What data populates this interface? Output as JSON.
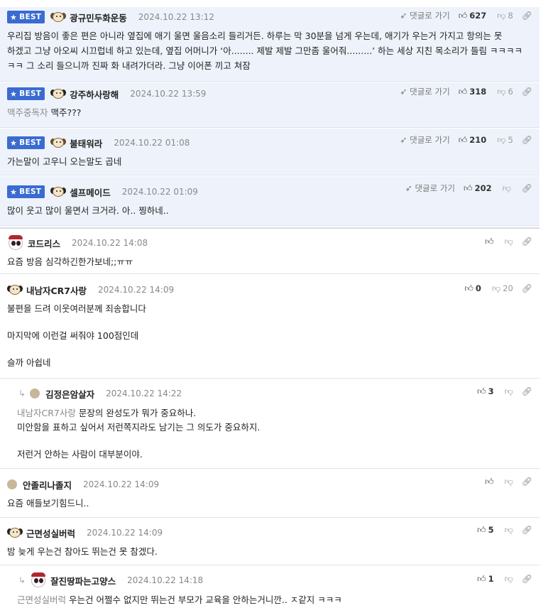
{
  "ui": {
    "best_label": "BEST",
    "goto_label": "댓글로 가기"
  },
  "comments": [
    {
      "nick": "광규민두화운동",
      "date": "2024.10.22 13:12",
      "likes": "627",
      "dislikes": "8",
      "lines": [
        "우리집 방음이 좋은 편은 아니라 옆집에 애기 울면 울음소리 들리거든. 하루는 막 30분을 넘게 우는데, 애기가 우는거 가지고 항의는 못",
        "하겠고 그냥 아오씨 시끄럽네 하고 있는데, 옆집 어머니가 ‘아........ 제발 제발 그만좀 울어줘.........’ 하는 세상 지친 목소리가 들림 ㅋㅋㅋㅋ",
        "ㅋㅋ 그 소리 들으니까 진짜 화 내려가더라. 그냥 이어폰 끼고 쳐잠"
      ]
    },
    {
      "nick": "강주하사랑해",
      "date": "2024.10.22 13:59",
      "likes": "318",
      "dislikes": "6",
      "ref": "맥주중독자",
      "text": "맥주???"
    },
    {
      "nick": "불태워라",
      "date": "2024.10.22 01:08",
      "likes": "210",
      "dislikes": "5",
      "text": "가는말이 고우니 오는말도 곱네"
    },
    {
      "nick": "셀프메이드",
      "date": "2024.10.22 01:09",
      "likes": "202",
      "dislikes": "",
      "text": "많이 웃고 많이 울면서 크거라. 아.. 찡하네.."
    },
    {
      "nick": "코드리스",
      "date": "2024.10.22 14:08",
      "text": "요즘 방음 심각하긴한가보네;;ㅠㅠ"
    },
    {
      "nick": "내남자CR7사랑",
      "date": "2024.10.22 14:09",
      "likes": "0",
      "dislikes": "20",
      "lines": [
        "불편을 드려 이웃여러분께 죄송합니다",
        "마지막에 이런걸 써줘야 100점인데",
        "슬까 아쉽네"
      ]
    },
    {
      "nick": "김정은암살자",
      "date": "2024.10.22 14:22",
      "likes": "3",
      "ref": "내남자CR7사랑",
      "lines": [
        "문장의 완성도가 뭐가 중요하나.",
        "미안함을 표하고 싶어서 저런쪽지라도 남기는 그 의도가 중요하지.",
        "저런거 안하는 사람이 대부분이야."
      ]
    },
    {
      "nick": "안졸리나졸지",
      "date": "2024.10.22 14:09",
      "text": "요즘 애들보기힘드니.."
    },
    {
      "nick": "근면성실버럭",
      "date": "2024.10.22 14:09",
      "likes": "5",
      "text": "밤 늦게 우는건 참아도 뛰는건 못 참겠다."
    },
    {
      "nick": "잘진땅파는고양스",
      "date": "2024.10.22 14:18",
      "likes": "1",
      "ref": "근면성실버럭",
      "text": "우는건 어쩔수 없지만 뛰는건 부모가 교육을 안하는거니깐.. ㅈ같지 ㅋㅋㅋ"
    }
  ]
}
